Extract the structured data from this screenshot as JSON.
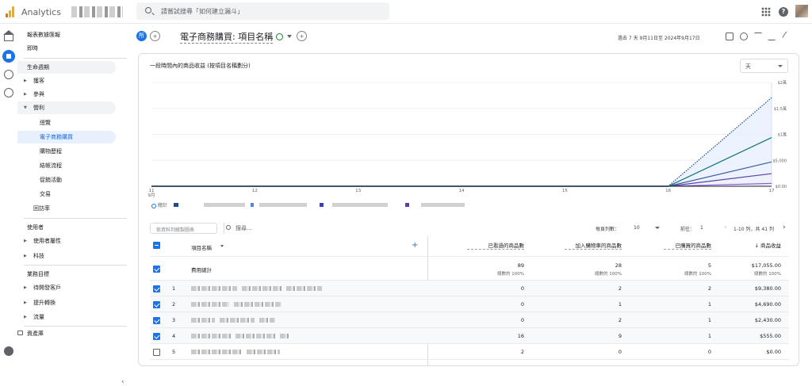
{
  "app": {
    "title": "Analytics"
  },
  "search": {
    "placeholder": "請嘗試搜尋「如何建立漏斗」"
  },
  "nav": {
    "snapshot": "報表數據匯報",
    "realtime": "即時",
    "lifecycle": "生命週期",
    "acquisition": "獲客",
    "engagement": "參與",
    "monetization": "營利",
    "overview": "總覽",
    "ecommerce": "電子商務購買",
    "purchase_journey": "購物歷程",
    "checkout_journey": "結帳流程",
    "promotions": "促銷活動",
    "transactions": "交易",
    "retention": "回訪率",
    "user": "使用者",
    "user_attributes": "使用者屬性",
    "tech": "科技",
    "business_objectives": "業務目標",
    "leads": "待開發客戶",
    "conversions": "提升轉換",
    "traffic": "流量",
    "library": "資產庫"
  },
  "header": {
    "all_pill": "所",
    "title": "電子商務購買: 項目名稱",
    "date_range": "過去 7 天  9月11日至 2024年9月17日"
  },
  "chart_card": {
    "title": "一段時間內的商品收益 (按項目名稱劃分)",
    "period": "天",
    "legend_total": "總計"
  },
  "chart_data": {
    "type": "line",
    "x": [
      "11 9月",
      "12",
      "13",
      "14",
      "15",
      "16",
      "17"
    ],
    "y_ticks": [
      "$0.00",
      "$5,000",
      "$1萬",
      "$1.5萬",
      "$2萬"
    ],
    "ylim": [
      0,
      20000
    ],
    "series": [
      {
        "style": "dotted",
        "color": "#1a4f8b",
        "values": [
          0,
          0,
          0,
          0,
          0,
          0,
          17055
        ]
      },
      {
        "style": "solid",
        "color": "#12757a",
        "values": [
          0,
          0,
          0,
          0,
          0,
          0,
          9380
        ]
      },
      {
        "style": "solid",
        "color": "#3d5aa6",
        "values": [
          0,
          0,
          0,
          0,
          0,
          0,
          4690
        ]
      },
      {
        "style": "solid",
        "color": "#5b3ea8",
        "values": [
          0,
          0,
          0,
          0,
          0,
          0,
          2430
        ]
      },
      {
        "style": "solid",
        "color": "#8f5bd6",
        "values": [
          0,
          0,
          0,
          0,
          0,
          0,
          555
        ]
      }
    ]
  },
  "table": {
    "dim_placeholder": "依資料列繪製圖表",
    "search_placeholder": "搜尋...",
    "rows_per_page_label": "每頁列數：",
    "rows_per_page": "10",
    "goto_label": "前往：",
    "goto_value": "1",
    "range_text": "1-10 列，共 41 列",
    "add_col": "+",
    "dim_header": "項目名稱",
    "columns": [
      "已看過的商品數",
      "加入購物車的商品數",
      "已購買的商品數",
      "↓ 商品收益"
    ],
    "totals_label": "費用總計",
    "totals": [
      "89",
      "28",
      "5",
      "$17,055.00"
    ],
    "totals_sub": [
      "總數的 100%",
      "總數的 100%",
      "總數的 100%",
      "總數的 100%"
    ],
    "rows": [
      {
        "n": "1",
        "v": [
          "0",
          "2",
          "2",
          "$9,380.00"
        ]
      },
      {
        "n": "2",
        "v": [
          "0",
          "1",
          "1",
          "$4,690.00"
        ]
      },
      {
        "n": "3",
        "v": [
          "0",
          "2",
          "1",
          "$2,430.00"
        ]
      },
      {
        "n": "4",
        "v": [
          "16",
          "9",
          "1",
          "$555.00"
        ]
      },
      {
        "n": "5",
        "v": [
          "2",
          "0",
          "0",
          "$0.00"
        ]
      }
    ]
  }
}
